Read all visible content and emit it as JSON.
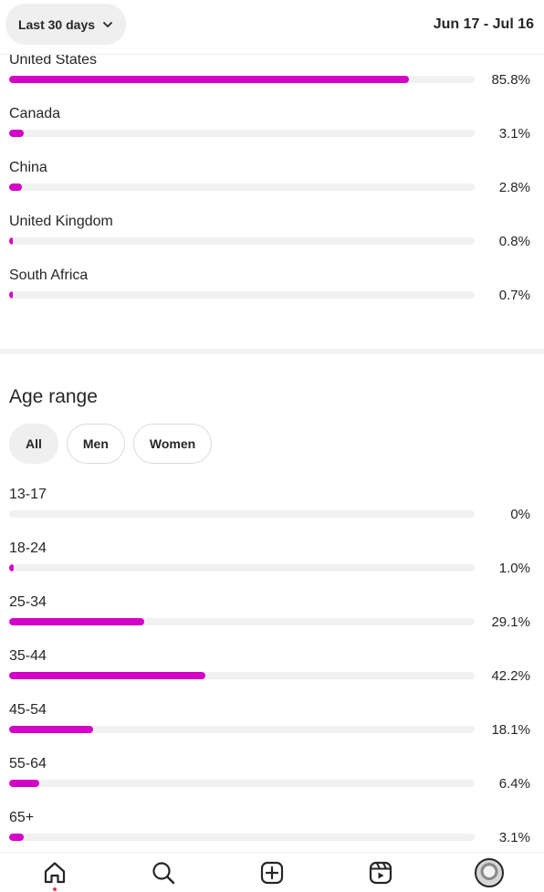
{
  "header": {
    "range_label": "Last 30 days",
    "date_range": "Jun 17 - Jul 16"
  },
  "countries": [
    {
      "label": "United States",
      "value": 85.8,
      "display": "85.8%"
    },
    {
      "label": "Canada",
      "value": 3.1,
      "display": "3.1%"
    },
    {
      "label": "China",
      "value": 2.8,
      "display": "2.8%"
    },
    {
      "label": "United Kingdom",
      "value": 0.8,
      "display": "0.8%"
    },
    {
      "label": "South Africa",
      "value": 0.7,
      "display": "0.7%"
    }
  ],
  "age_range": {
    "title": "Age range",
    "filters": [
      {
        "label": "All",
        "selected": true
      },
      {
        "label": "Men",
        "selected": false
      },
      {
        "label": "Women",
        "selected": false
      }
    ],
    "rows": [
      {
        "label": "13-17",
        "value": 0,
        "display": "0%"
      },
      {
        "label": "18-24",
        "value": 1.0,
        "display": "1.0%"
      },
      {
        "label": "25-34",
        "value": 29.1,
        "display": "29.1%"
      },
      {
        "label": "35-44",
        "value": 42.2,
        "display": "42.2%"
      },
      {
        "label": "45-54",
        "value": 18.1,
        "display": "18.1%"
      },
      {
        "label": "55-64",
        "value": 6.4,
        "display": "6.4%"
      },
      {
        "label": "65+",
        "value": 3.1,
        "display": "3.1%"
      }
    ]
  },
  "bottom_nav": {
    "items": [
      {
        "icon": "home-icon",
        "active": true
      },
      {
        "icon": "search-icon",
        "active": false
      },
      {
        "icon": "create-icon",
        "active": false
      },
      {
        "icon": "reels-icon",
        "active": false
      },
      {
        "icon": "profile-avatar",
        "active": false
      }
    ]
  },
  "colors": {
    "bar_fill": "#d300c5",
    "bar_track": "#f1f1f1",
    "notification_dot": "#ff3040"
  }
}
